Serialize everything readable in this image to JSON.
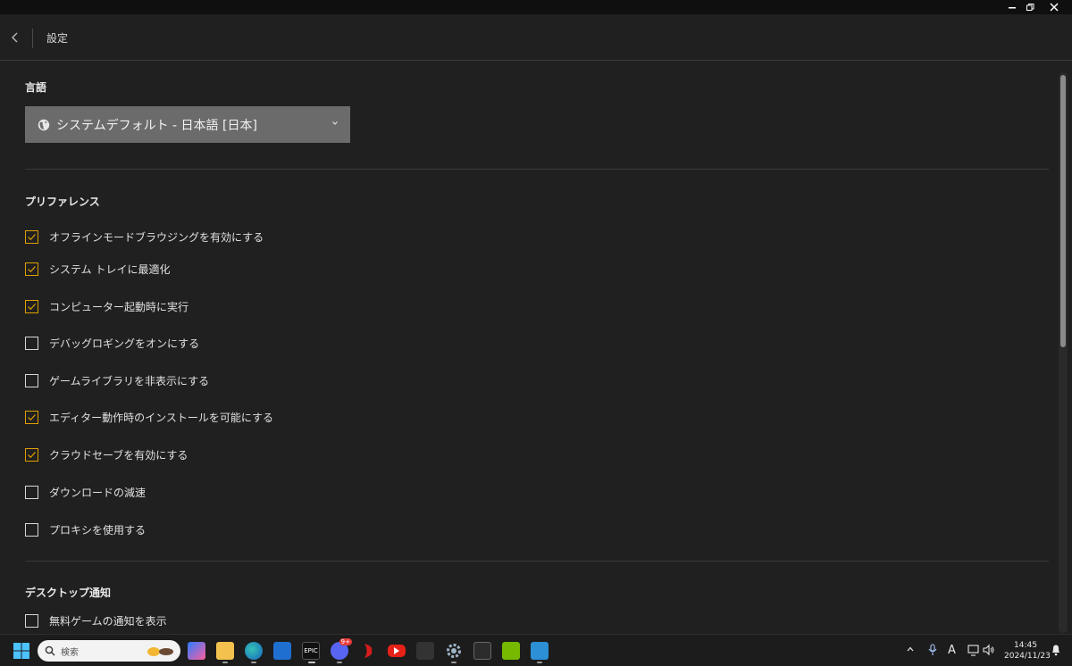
{
  "window": {
    "controls": [
      "minimize",
      "restore",
      "close"
    ]
  },
  "header": {
    "title": "設定"
  },
  "language": {
    "section_title": "言語",
    "selected": "システムデフォルト - 日本語 [日本]"
  },
  "preferences": {
    "section_title": "プリファレンス",
    "items": [
      {
        "label": "オフラインモードブラウジングを有効にする",
        "checked": true
      },
      {
        "label": "システム トレイに最適化",
        "checked": true
      },
      {
        "label": "コンピューター起動時に実行",
        "checked": true
      },
      {
        "label": "デバッグロギングをオンにする",
        "checked": false
      },
      {
        "label": "ゲームライブラリを非表示にする",
        "checked": false
      },
      {
        "label": "エディター動作時のインストールを可能にする",
        "checked": true
      },
      {
        "label": "クラウドセーブを有効にする",
        "checked": true
      },
      {
        "label": "ダウンロードの減速",
        "checked": false
      },
      {
        "label": "プロキシを使用する",
        "checked": false
      }
    ]
  },
  "desktop_notifications": {
    "section_title": "デスクトップ通知",
    "items": [
      {
        "label": "無料ゲームの通知を表示",
        "checked": false
      }
    ]
  },
  "colors": {
    "background": "#202020",
    "check_accent": "#e0a000",
    "dropdown": "#6b6b6b"
  },
  "taskbar": {
    "search_placeholder": "検索",
    "epic_label": "EPIC",
    "discord_badge": "9+",
    "tray_ime": "A",
    "time": "14:45",
    "date": "2024/11/23"
  }
}
